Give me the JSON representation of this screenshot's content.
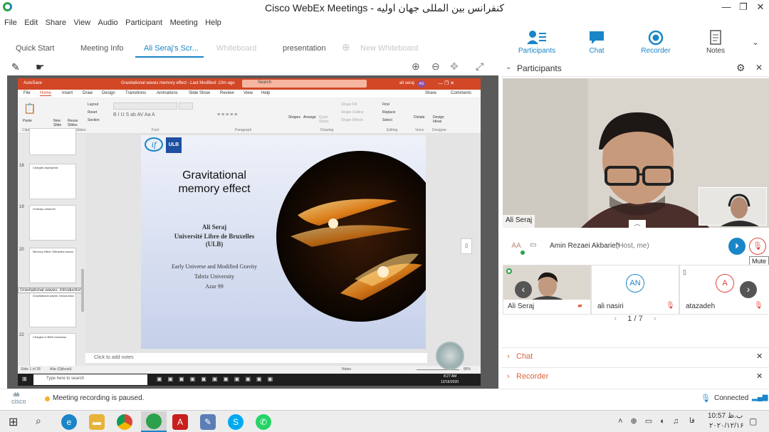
{
  "window": {
    "title": "Cisco WebEx Meetings - کنفرانس بین المللی جهان اولیه",
    "minimize": "—",
    "restore": "❐",
    "close": "✕"
  },
  "menu": [
    "File",
    "Edit",
    "Share",
    "View",
    "Audio",
    "Participant",
    "Meeting",
    "Help"
  ],
  "tabs": {
    "quick_start": "Quick Start",
    "meeting_info": "Meeting Info",
    "active": "Ali Seraj's Scr...",
    "whiteboard": "Whiteboard",
    "presentation": "presentation",
    "new_whiteboard": "New Whiteboard"
  },
  "right_toolbar": {
    "participants": "Participants",
    "chat": "Chat",
    "recorder": "Recorder",
    "notes": "Notes"
  },
  "ppt": {
    "title_text": "Gravitational waves memory effect - Last Modified: 10m ago",
    "autosave": "AutoSave",
    "search_placeholder": "Search",
    "user": "ali seraj",
    "user_initials": "AS",
    "menu": [
      "File",
      "Home",
      "Insert",
      "Draw",
      "Design",
      "Transitions",
      "Animations",
      "Slide Show",
      "Review",
      "View",
      "Help"
    ],
    "share_btn": "Share",
    "comments_btn": "Comments",
    "ribbon_groups": [
      "Clipboard",
      "Slides",
      "Font",
      "Paragraph",
      "Drawing",
      "Editing",
      "Voice",
      "Designer"
    ],
    "ribbon_controls": {
      "paste": "Paste",
      "new_slide": "New Slide",
      "reuse_slides": "Reuse Slides",
      "layout": "Layout",
      "reset": "Reset",
      "section": "Section",
      "shapes": "Shapes",
      "arrange": "Arrange",
      "quick_styles": "Quick Styles",
      "shape_fill": "Shape Fill",
      "shape_outline": "Shape Outline",
      "shape_effects": "Shape Effects",
      "find": "Find",
      "replace": "Replace",
      "select": "Select",
      "dictate": "Dictate",
      "design_ideas": "Design Ideas"
    },
    "thumbs": [
      {
        "num": "18",
        "title": "Charged asymptotic"
      },
      {
        "num": "19",
        "title": "Ordinary observer"
      },
      {
        "num": "20",
        "title": "Memory effect: Diffracted waves"
      },
      {
        "num": "",
        "title": "Gravitational waves: Introduction"
      },
      {
        "num": "22",
        "title": "Charges in BMS extension"
      }
    ],
    "tooltip": "Gravitational waves: Introduction",
    "notes_placeholder": "Click to add notes",
    "status_left": "Slide 1 of 28",
    "status_lang": "Afar (Djibouti)",
    "status_notes": "Notes",
    "status_zoom": "86%",
    "taskbar_search": "Type here to search",
    "taskbar_time": "8:27 AM",
    "taskbar_date": "12/16/2020"
  },
  "slide": {
    "title_line1": "Gravitational",
    "title_line2": "memory effect",
    "author": "Ali Seraj",
    "affil1": "Université Libre de Bruxelles",
    "affil2": "(ULB)",
    "event1": "Early Universe and Modified Gravity",
    "event2": "Tabriz University",
    "event3": "Azar 99",
    "logo1": "if",
    "logo2": "ULB"
  },
  "participants_panel": {
    "header": "Participants",
    "presenter_name": "Ali Seraj",
    "host_initials": "AA",
    "host_name": "Amin Rezaei Akbarieh",
    "host_tag": "(Host, me)",
    "mute_tooltip": "Mute",
    "tiles": [
      {
        "name": "Ali Seraj",
        "initials": ""
      },
      {
        "name": "ali nasiri",
        "initials": "AN"
      },
      {
        "name": "atazadeh",
        "initials": "A"
      }
    ],
    "page_current": "1",
    "page_total": "/ 7"
  },
  "sections": {
    "chat": "Chat",
    "recorder": "Recorder"
  },
  "status": {
    "brand": "cisco",
    "recording": "Meeting recording is paused.",
    "connection": "Connected"
  },
  "windows_taskbar": {
    "time": "10:57 ب.ظ",
    "date": "۲۰۲۰/۱۲/۱۶",
    "lang": "فا"
  },
  "colors": {
    "accent": "#1a85c7",
    "ppt_red": "#d24726",
    "section_orange": "#d9653b",
    "mute_red": "#e0443a"
  }
}
